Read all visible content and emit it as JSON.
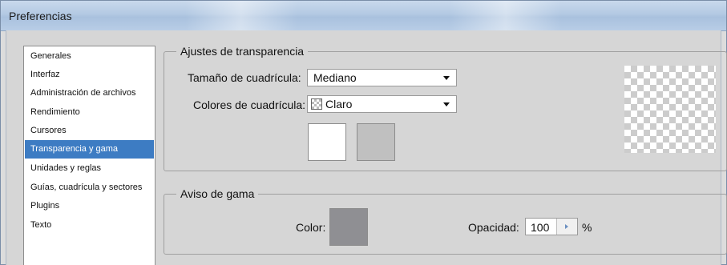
{
  "window": {
    "title": "Preferencias"
  },
  "sidebar": {
    "items": [
      {
        "label": "Generales",
        "selected": false
      },
      {
        "label": "Interfaz",
        "selected": false
      },
      {
        "label": "Administración de archivos",
        "selected": false
      },
      {
        "label": "Rendimiento",
        "selected": false
      },
      {
        "label": "Cursores",
        "selected": false
      },
      {
        "label": "Transparencia y gama",
        "selected": true
      },
      {
        "label": "Unidades y reglas",
        "selected": false
      },
      {
        "label": "Guías, cuadrícula y sectores",
        "selected": false
      },
      {
        "label": "Plugins",
        "selected": false
      },
      {
        "label": "Texto",
        "selected": false
      }
    ]
  },
  "transparency": {
    "group_label": "Ajustes de transparencia",
    "grid_size_label": "Tamaño de cuadrícula:",
    "grid_size_value": "Mediano",
    "grid_colors_label": "Colores de cuadrícula:",
    "grid_colors_value": "Claro",
    "color1": "#ffffff",
    "color2": "#c0c0c0"
  },
  "gamut": {
    "group_label": "Aviso de gama",
    "color_label": "Color:",
    "color_value": "#8f8f93",
    "opacity_label": "Opacidad:",
    "opacity_value": "100",
    "opacity_unit": "%"
  },
  "colors": {
    "selection": "#3d7cc3"
  }
}
